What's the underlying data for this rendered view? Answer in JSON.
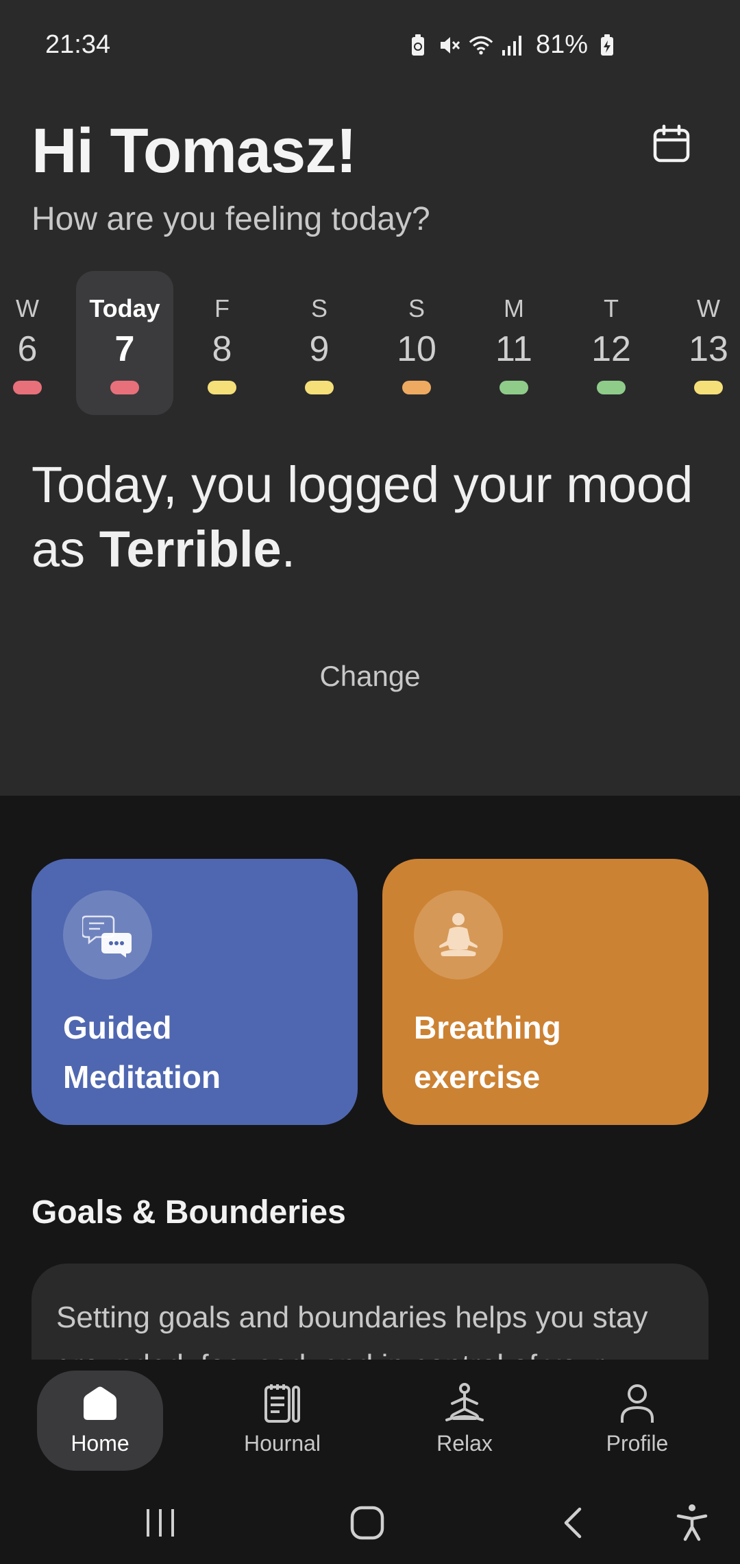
{
  "status_bar": {
    "time": "21:34",
    "battery": "81%"
  },
  "header": {
    "greeting": "Hi Tomasz!",
    "subtitle": "How are you feeling today?"
  },
  "week": [
    {
      "dow": "W",
      "num": "6",
      "mood_color": "#e8707a",
      "today": false
    },
    {
      "dow": "Today",
      "num": "7",
      "mood_color": "#e8707a",
      "today": true
    },
    {
      "dow": "F",
      "num": "8",
      "mood_color": "#f5df78",
      "today": false
    },
    {
      "dow": "S",
      "num": "9",
      "mood_color": "#f5df78",
      "today": false
    },
    {
      "dow": "S",
      "num": "10",
      "mood_color": "#eeaa60",
      "today": false
    },
    {
      "dow": "M",
      "num": "11",
      "mood_color": "#8fcc8a",
      "today": false
    },
    {
      "dow": "T",
      "num": "12",
      "mood_color": "#8fcc8a",
      "today": false
    },
    {
      "dow": "W",
      "num": "13",
      "mood_color": "#f5df78",
      "today": false
    }
  ],
  "mood": {
    "prefix": "Today, you logged your mood as ",
    "value": "Terrible",
    "suffix": ".",
    "change_label": "Change"
  },
  "cards": {
    "meditation": {
      "title": "Guided Meditation",
      "icon": "chat-bubbles-icon",
      "color": "#4f67b0"
    },
    "breathing": {
      "title": "Breathing exercise",
      "icon": "meditation-pose-icon",
      "color": "#cc8233"
    }
  },
  "goals": {
    "title": "Goals & Bounderies",
    "text": "Setting goals and boundaries helps you stay grounded, focused, and in control of your"
  },
  "nav": {
    "home": "Home",
    "journal": "Hournal",
    "relax": "Relax",
    "profile": "Profile"
  }
}
